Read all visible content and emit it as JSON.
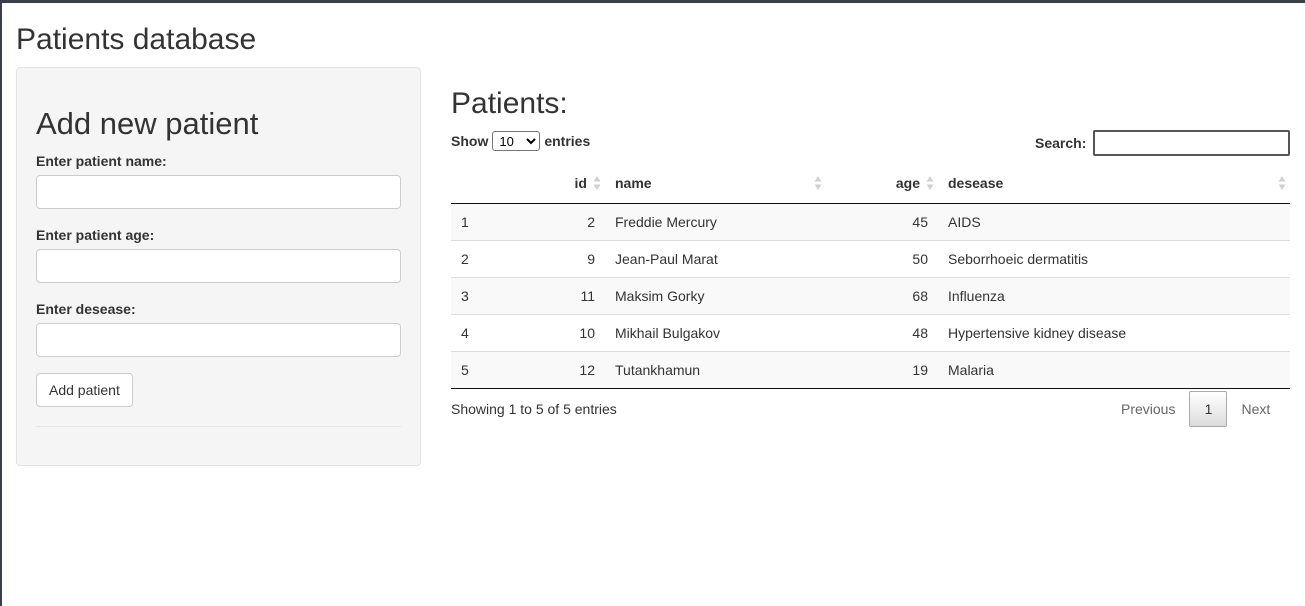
{
  "page": {
    "title": "Patients database"
  },
  "form": {
    "heading": "Add new patient",
    "name_label": "Enter patient name:",
    "age_label": "Enter patient age:",
    "disease_label": "Enter desease:",
    "name_value": "",
    "age_value": "",
    "disease_value": "",
    "submit_label": "Add patient"
  },
  "main": {
    "heading": "Patients:",
    "length": {
      "prefix": "Show",
      "selected": "10",
      "suffix": "entries"
    },
    "search": {
      "label": "Search:",
      "value": ""
    },
    "table": {
      "headers": {
        "index": "",
        "id": "id",
        "name": "name",
        "age": "age",
        "disease": "desease"
      },
      "rows": [
        {
          "index": "1",
          "id": "2",
          "name": "Freddie Mercury",
          "age": "45",
          "disease": "AIDS"
        },
        {
          "index": "2",
          "id": "9",
          "name": "Jean-Paul Marat",
          "age": "50",
          "disease": "Seborrhoeic dermatitis"
        },
        {
          "index": "3",
          "id": "11",
          "name": "Maksim Gorky",
          "age": "68",
          "disease": "Influenza"
        },
        {
          "index": "4",
          "id": "10",
          "name": "Mikhail Bulgakov",
          "age": "48",
          "disease": "Hypertensive kidney disease"
        },
        {
          "index": "5",
          "id": "12",
          "name": "Tutankhamun",
          "age": "19",
          "disease": "Malaria"
        }
      ]
    },
    "info": "Showing 1 to 5 of 5 entries",
    "pagination": {
      "previous": "Previous",
      "current": "1",
      "next": "Next"
    }
  },
  "icons": {
    "sort": "sort-both-icon"
  },
  "colors": {
    "text": "#333333",
    "panel_bg": "#f5f5f5",
    "stripe_bg": "#f9f9f9"
  }
}
